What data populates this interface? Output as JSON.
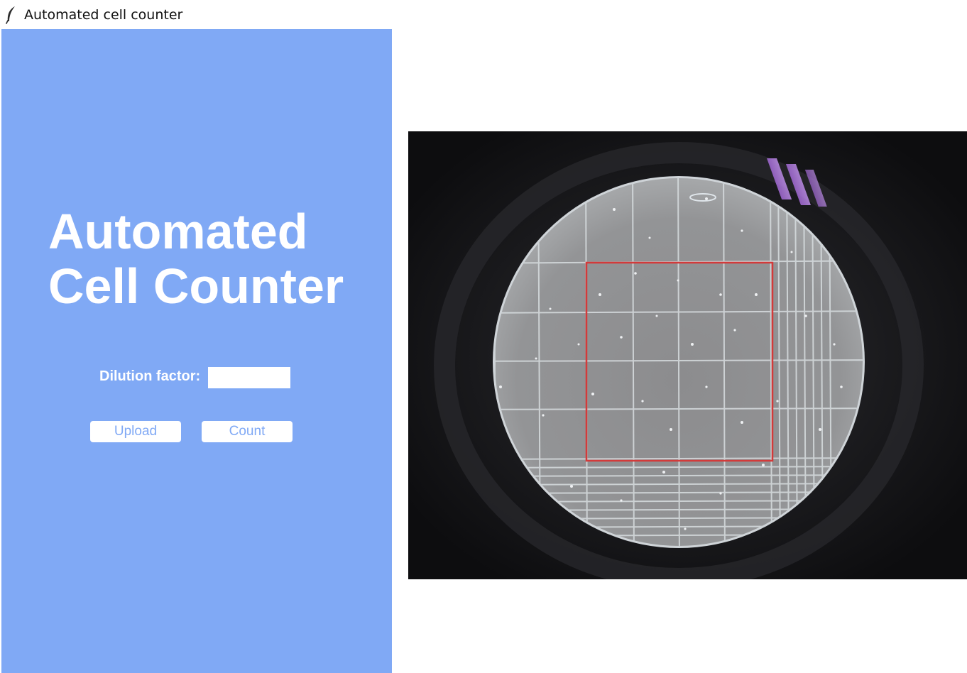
{
  "window": {
    "title": "Automated cell counter",
    "icon": "feather-icon"
  },
  "panel": {
    "background_color": "#80a9f5",
    "heading": "Automated\nCell Counter",
    "dilution_label": "Dilution factor:",
    "dilution_value": "",
    "upload_label": "Upload",
    "count_label": "Count"
  },
  "image": {
    "description_icon": "microscope-image",
    "roi_color": "#d33a3a"
  }
}
